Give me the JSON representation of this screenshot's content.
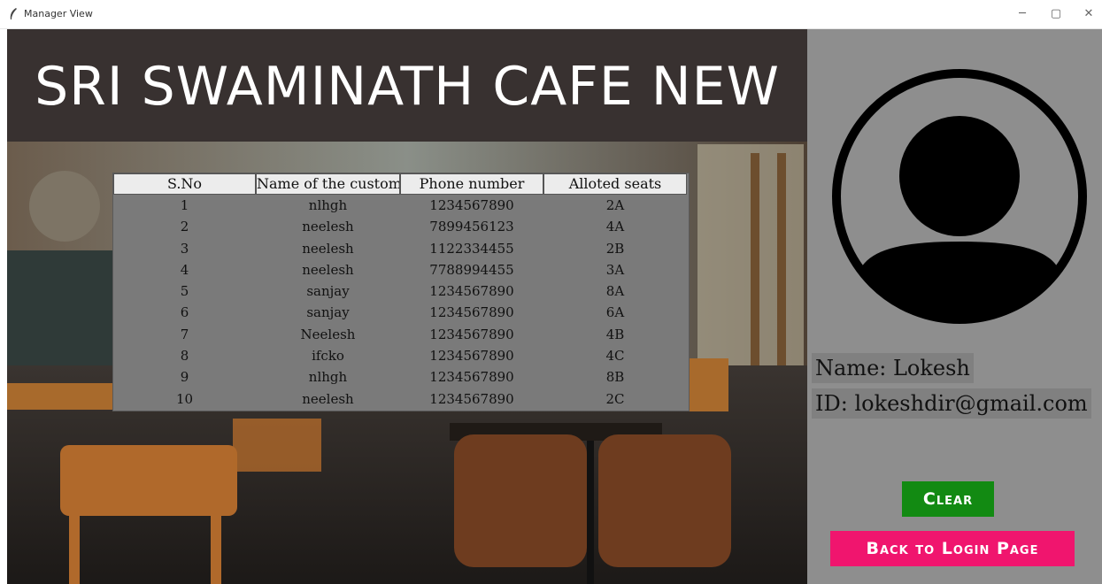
{
  "window": {
    "title": "Manager View",
    "controls": {
      "minimize": "─",
      "maximize": "▢",
      "close": "✕"
    }
  },
  "header": {
    "title": "SRI SWAMINATH CAFE NEW"
  },
  "table": {
    "columns": [
      "S.No",
      "Name of the customer",
      "Phone number",
      "Alloted seats"
    ],
    "rows": [
      [
        "1",
        "nlhgh",
        "1234567890",
        "2A"
      ],
      [
        "2",
        "neelesh",
        "7899456123",
        "4A"
      ],
      [
        "3",
        "neelesh",
        "1122334455",
        "2B"
      ],
      [
        "4",
        "neelesh",
        "7788994455",
        "3A"
      ],
      [
        "5",
        "sanjay",
        "1234567890",
        "8A"
      ],
      [
        "6",
        "sanjay",
        "1234567890",
        "6A"
      ],
      [
        "7",
        "Neelesh",
        "1234567890",
        "4B"
      ],
      [
        "8",
        "ifcko",
        "1234567890",
        "4C"
      ],
      [
        "9",
        "nlhgh",
        "1234567890",
        "8B"
      ],
      [
        "10",
        "neelesh",
        "1234567890",
        "2C"
      ]
    ]
  },
  "profile": {
    "icon": "user-avatar-icon",
    "name_label": "Name: Lokesh",
    "id_label": "ID: lokeshdir@gmail.com"
  },
  "buttons": {
    "clear": "Clear",
    "back": "Back to Login Page"
  },
  "colors": {
    "header_bg": "#383130",
    "side_panel_bg": "#8e8e8e",
    "clear_button": "#128a12",
    "back_button": "#f0156e",
    "table_bg": "#7a7a7a"
  }
}
